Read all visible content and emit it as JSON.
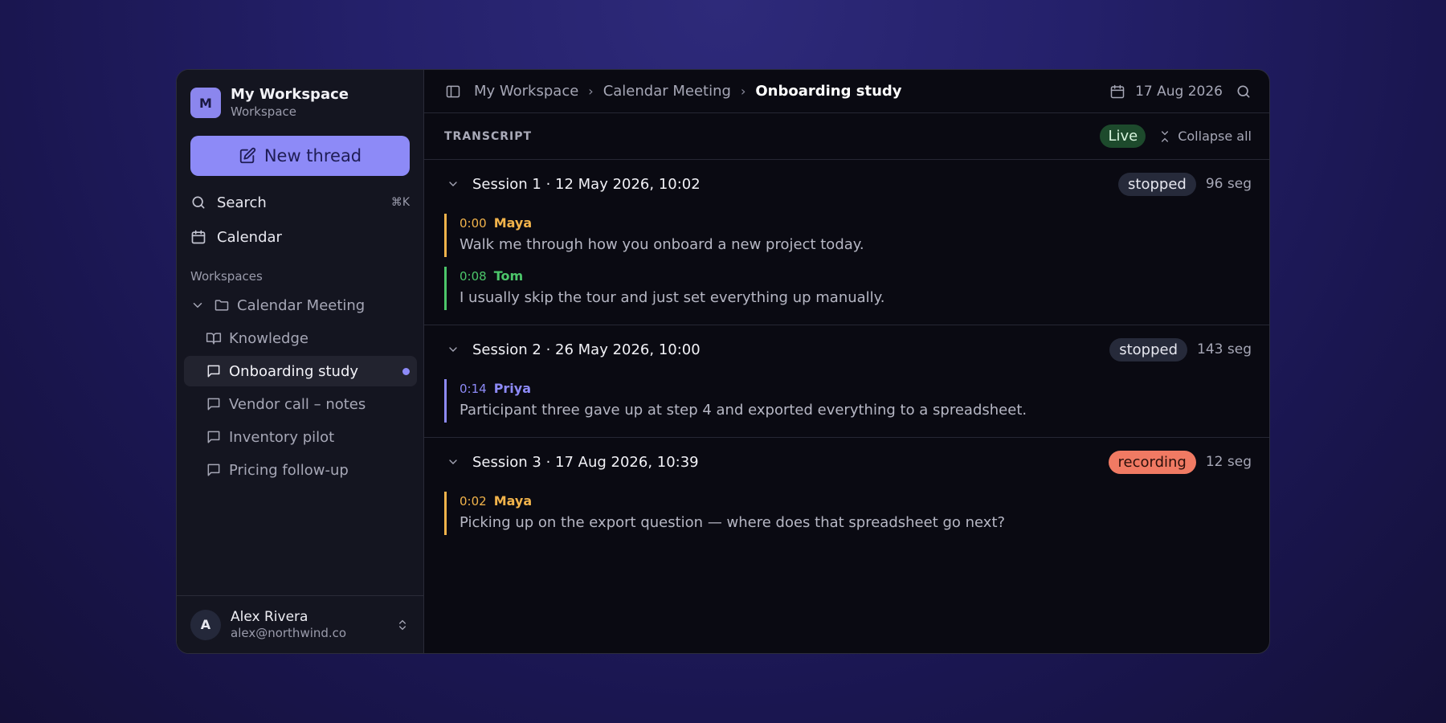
{
  "workspace": {
    "initial": "M",
    "name": "My Workspace",
    "sub": "Workspace"
  },
  "new_thread_label": "New thread",
  "nav": {
    "search_label": "Search",
    "search_shortcut": "⌘K",
    "calendar_label": "Calendar"
  },
  "sidebar": {
    "section_label": "Workspaces",
    "folder": "Calendar Meeting",
    "items": [
      {
        "label": "Knowledge",
        "icon": "book-icon",
        "active": false
      },
      {
        "label": "Onboarding study",
        "icon": "chat-icon",
        "active": true
      },
      {
        "label": "Vendor call – notes",
        "icon": "chat-icon",
        "active": false
      },
      {
        "label": "Inventory pilot",
        "icon": "chat-icon",
        "active": false
      },
      {
        "label": "Pricing follow-up",
        "icon": "chat-icon",
        "active": false
      }
    ]
  },
  "user": {
    "initial": "A",
    "name": "Alex Rivera",
    "email": "alex@northwind.co"
  },
  "breadcrumb": {
    "root": "My Workspace",
    "parent": "Calendar Meeting",
    "current": "Onboarding study",
    "sep": "›"
  },
  "top_date": "17 Aug 2026",
  "transcript": {
    "label": "TRANSCRIPT",
    "live": "Live",
    "collapse": "Collapse all"
  },
  "sessions": [
    {
      "title": "Session 1 · 12 May 2026, 10:02",
      "status": "stopped",
      "segs": "96 seg",
      "utterances": [
        {
          "time": "0:00",
          "speaker": "Maya",
          "color": "#f1b34b",
          "text": "Walk me through how you onboard a new project today."
        },
        {
          "time": "0:08",
          "speaker": "Tom",
          "color": "#4cc66a",
          "text": "I usually skip the tour and just set everything up manually."
        }
      ]
    },
    {
      "title": "Session 2 · 26 May 2026, 10:00",
      "status": "stopped",
      "segs": "143 seg",
      "utterances": [
        {
          "time": "0:14",
          "speaker": "Priya",
          "color": "#8d8af7",
          "text": "Participant three gave up at step 4 and exported everything to a spreadsheet."
        }
      ]
    },
    {
      "title": "Session 3 · 17 Aug 2026, 10:39",
      "status": "recording",
      "segs": "12 seg",
      "utterances": [
        {
          "time": "0:02",
          "speaker": "Maya",
          "color": "#f1b34b",
          "text": "Picking up on the export question — where does that spreadsheet go next?"
        }
      ]
    }
  ]
}
